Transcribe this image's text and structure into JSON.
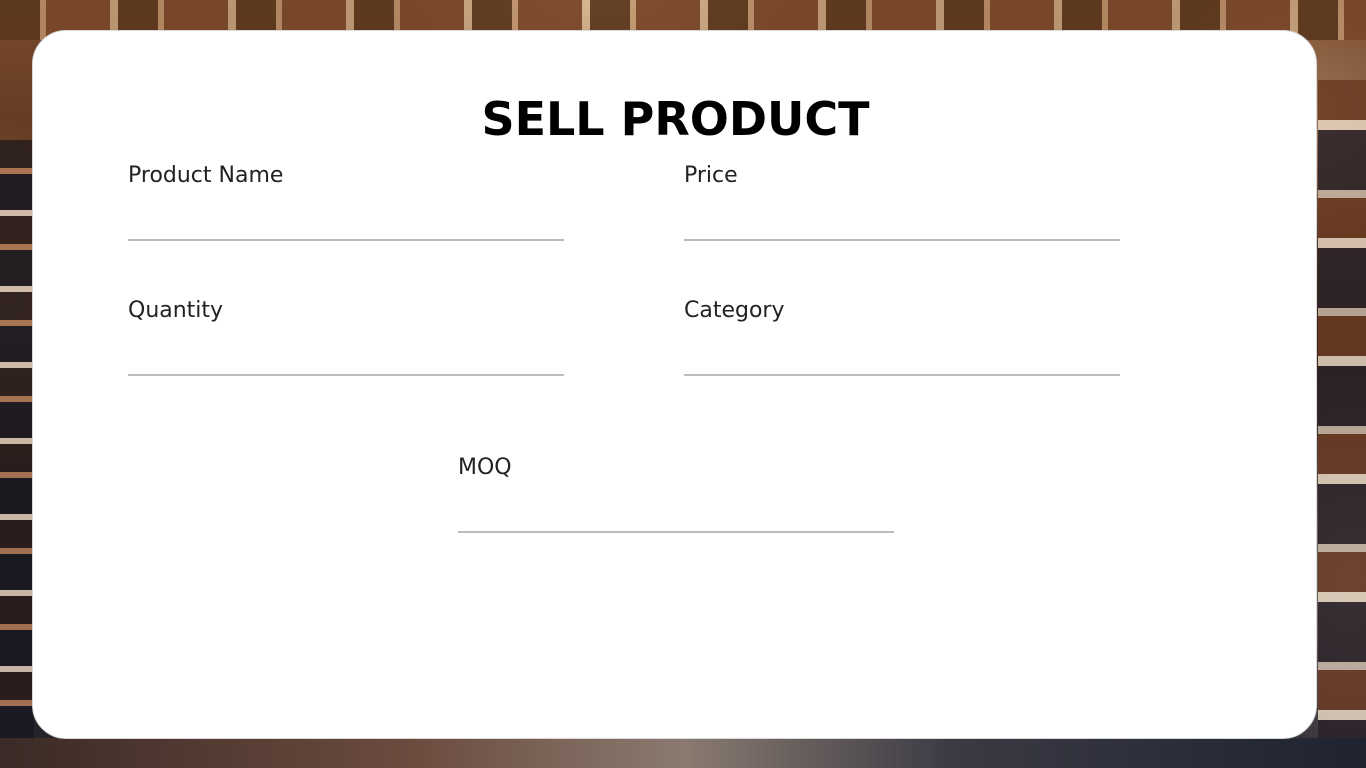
{
  "form": {
    "title": "SELL PRODUCT",
    "fields": {
      "product_name": {
        "label": "Product Name",
        "value": "",
        "placeholder": ""
      },
      "price": {
        "label": "Price",
        "value": "",
        "placeholder": ""
      },
      "quantity": {
        "label": "Quantity",
        "value": "",
        "placeholder": ""
      },
      "category": {
        "label": "Category",
        "value": "",
        "placeholder": ""
      },
      "moq": {
        "label": "MOQ",
        "value": "",
        "placeholder": ""
      }
    }
  },
  "colors": {
    "card_background": "#ffffff",
    "title_text": "#000000",
    "label_text": "#222222",
    "input_underline": "#bcbcbc"
  },
  "background": {
    "image": "warehouse-photo"
  }
}
